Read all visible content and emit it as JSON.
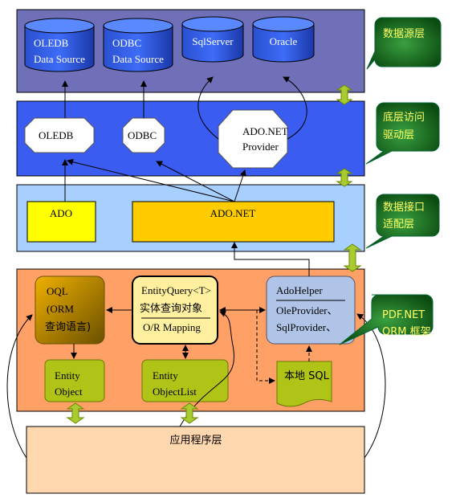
{
  "layers": {
    "datasource": {
      "color": "#7070b8"
    },
    "driver": {
      "color": "#3a5cf0"
    },
    "adapter": {
      "color": "#a8d0ff"
    },
    "orm": {
      "color": "#ffa066"
    },
    "app": {
      "color": "#ffd8b0",
      "label": "应用程序层"
    }
  },
  "databases": [
    {
      "line1": "OLEDB",
      "line2": "Data Source"
    },
    {
      "line1": "ODBC",
      "line2": "Data Source"
    },
    {
      "line1": "SqlServer",
      "line2": ""
    },
    {
      "line1": "Oracle",
      "line2": ""
    }
  ],
  "drivers": [
    {
      "line1": "OLEDB",
      "line2": ""
    },
    {
      "line1": "ODBC",
      "line2": ""
    },
    {
      "line1": "ADO.NET",
      "line2": "Provider"
    }
  ],
  "adapters": [
    {
      "label": "ADO",
      "color": "#ffff00"
    },
    {
      "label": "ADO.NET",
      "color": "#ffcc00"
    }
  ],
  "orm": {
    "oql": {
      "line1": "OQL",
      "line2": "(ORM",
      "line3": "查询语言)"
    },
    "entity_query": {
      "line1": "EntityQuery<T>",
      "line2": "实体查询对象",
      "line3": "O/R Mapping"
    },
    "ado_helper": {
      "line1": "AdoHelper",
      "line2": "OleProvider、",
      "line3": "SqlProvider、"
    },
    "entity_object": {
      "line1": "Entity",
      "line2": "Object"
    },
    "entity_object_list": {
      "line1": "Entity",
      "line2": "ObjectList"
    },
    "local_sql": {
      "label": "本地 SQL"
    }
  },
  "callouts": [
    {
      "line1": "数据源层",
      "line2": ""
    },
    {
      "line1": "底层访问",
      "line2": "驱动层"
    },
    {
      "line1": "数据接口",
      "line2": "适配层"
    },
    {
      "line1": "PDF.NET",
      "line2": "ORM 框架"
    }
  ]
}
